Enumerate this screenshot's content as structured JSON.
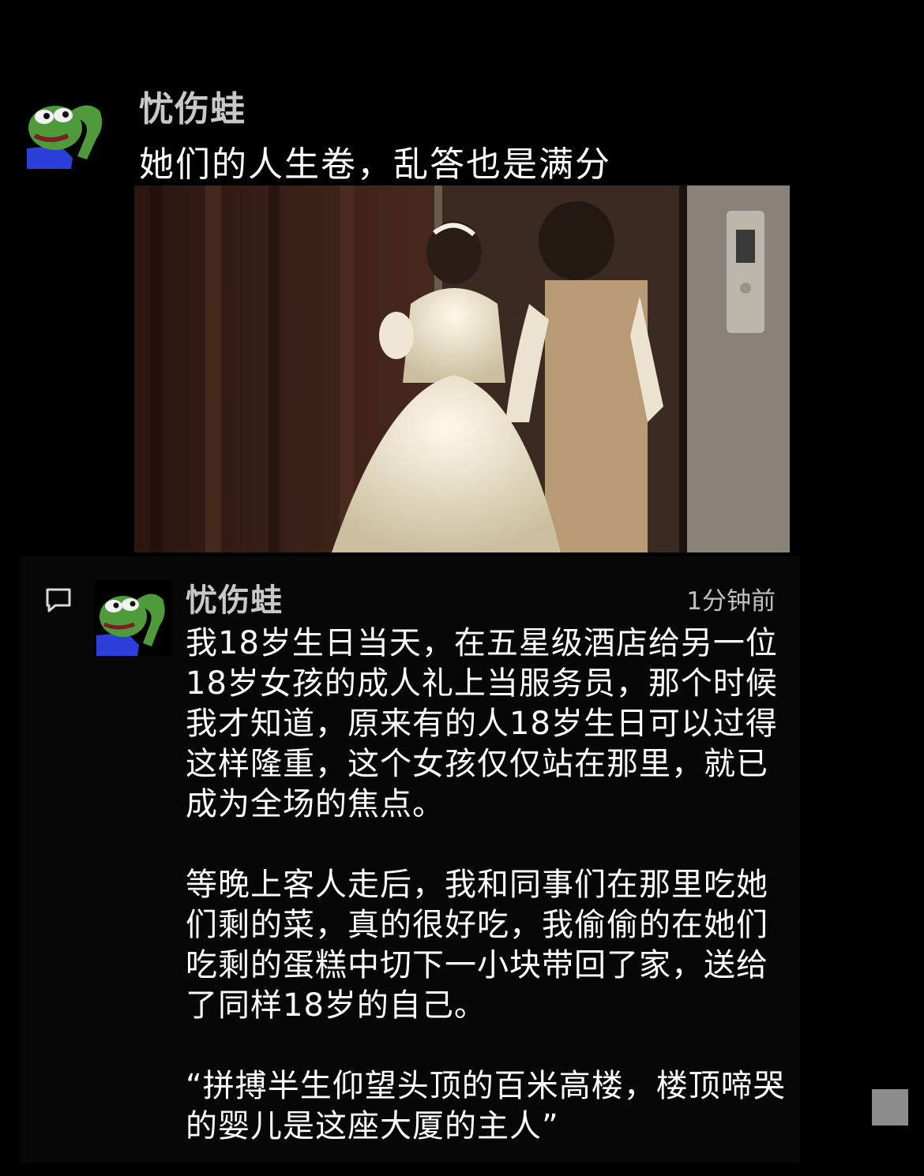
{
  "post": {
    "username": "忧伤蛙",
    "text": "她们的人生卷，乱答也是满分",
    "avatar_icon": "pepe-frog-avatar-icon",
    "photo_icon": "photo-bride-elevator-icon"
  },
  "comment": {
    "icon": "comment-bubble-icon",
    "avatar_icon": "pepe-frog-avatar-icon",
    "username": "忧伤蛙",
    "time": "1分钟前",
    "paragraphs": [
      "我18岁生日当天，在五星级酒店给另一位18岁女孩的成人礼上当服务员，那个时候我才知道，原来有的人18岁生日可以过得这样隆重，这个女孩仅仅站在那里，就已成为全场的焦点。",
      "等晚上客人走后，我和同事们在那里吃她们剩的菜，真的很好吃，我偷偷的在她们吃剩的蛋糕中切下一小块带回了家，送给了同样18岁的自己。",
      "“拼搏半生仰望头顶的百米高楼，楼顶啼哭的婴儿是这座大厦的主人”"
    ]
  },
  "colors": {
    "background": "#000000",
    "card": "#070707",
    "username": "#c8c8c8",
    "text": "#ffffff",
    "time": "#c0c0c0"
  }
}
